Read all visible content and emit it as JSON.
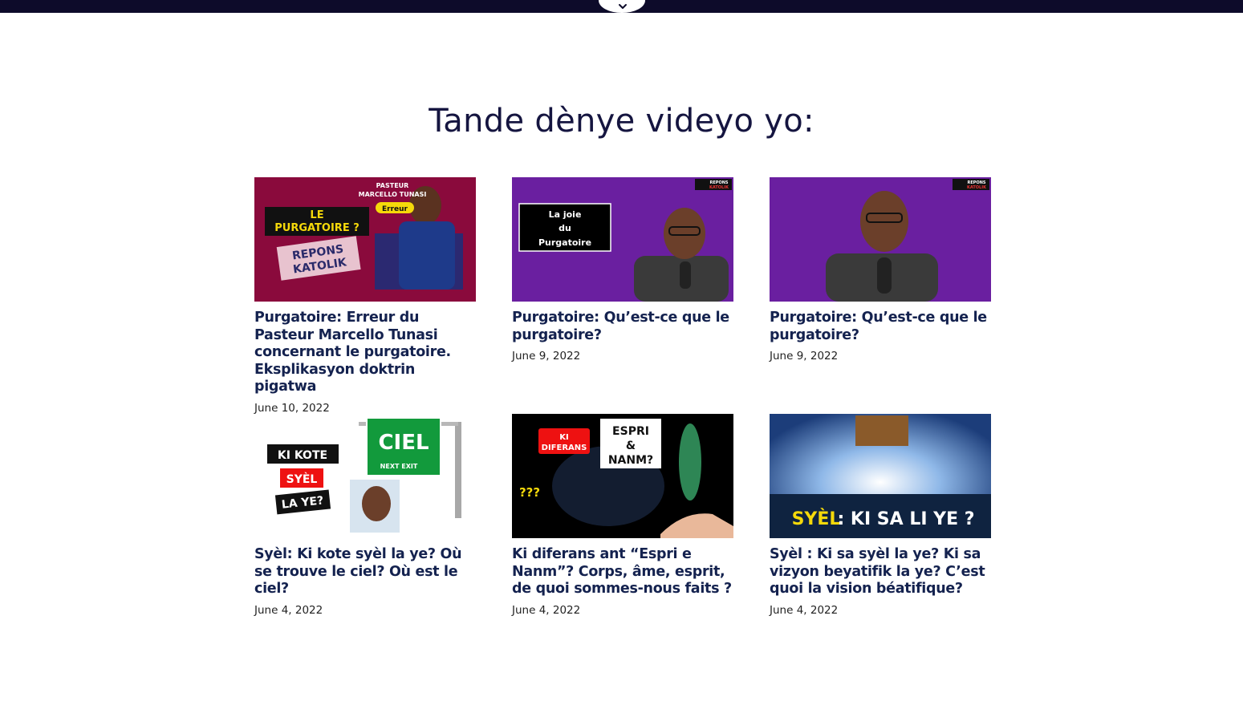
{
  "heading": "Tande dènye videyo yo:",
  "videos": [
    {
      "title": "Purgatoire: Erreur du Pasteur Marcello Tunasi concernant le purgatoire. Eksplikasyon doktrin pigatwa",
      "date": "June 10, 2022",
      "thumb": {
        "line1": "PASTEUR",
        "line2": "MARCELLO TUNASI",
        "tag": "Erreur",
        "banner1": "LE",
        "banner2": "PURGATOIRE ?",
        "badge1": "REPONS",
        "badge2": "KATOLIK",
        "bg": "#8a0a3c"
      }
    },
    {
      "title": "Purgatoire: Qu’est-ce que le purgatoire?",
      "date": "June 9, 2022",
      "thumb": {
        "box1": "La joie",
        "box2": "du",
        "box3": "Purgatoire",
        "logo1": "REPONS",
        "logo2": "KATOLIK",
        "bg": "#6a1fa0"
      }
    },
    {
      "title": "Purgatoire: Qu’est-ce que le purgatoire?",
      "date": "June 9, 2022",
      "thumb": {
        "logo1": "REPONS",
        "logo2": "KATOLIK",
        "bg": "#6a1fa0"
      }
    },
    {
      "title": "Syèl: Ki kote syèl la ye? Où se trouve le ciel? Où est le ciel?",
      "date": "June 4, 2022",
      "thumb": {
        "l1": "KI KOTE",
        "l2": "SYÈL",
        "l3": "LA YE?",
        "sign": "CIEL",
        "exit": "NEXT EXIT",
        "bg": "#ffffff"
      }
    },
    {
      "title": "Ki diferans ant “Espri e Nanm”? Corps, âme, esprit, de quoi sommes-nous faits ?",
      "date": "June 4, 2022",
      "thumb": {
        "tag1": "KI",
        "tag2": "DIFERANS",
        "q1": "ESPRI",
        "q2": "&",
        "q3": "NANM?",
        "marks": "???",
        "bg": "#000000"
      }
    },
    {
      "title": "Syèl : Ki sa syèl la ye? Ki sa vizyon beyatifik la ye? C’est quoi la vision béatifique?",
      "date": "June 4, 2022",
      "thumb": {
        "b1": "SYÈL",
        "b2": ": KI SA LI YE ?",
        "bg": "#1c3d7a"
      }
    }
  ]
}
